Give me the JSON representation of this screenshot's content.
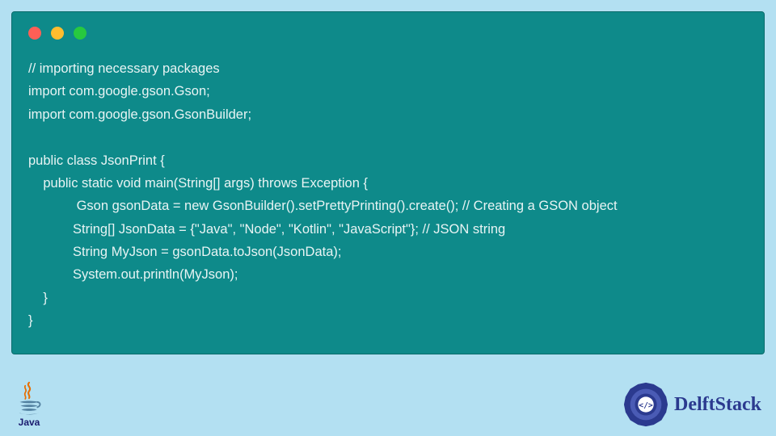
{
  "code": {
    "lines": [
      "// importing necessary packages",
      "import com.google.gson.Gson;",
      "import com.google.gson.GsonBuilder;",
      "",
      "public class JsonPrint {",
      "    public static void main(String[] args) throws Exception {",
      "             Gson gsonData = new GsonBuilder().setPrettyPrinting().create(); // Creating a GSON object",
      "            String[] JsonData = {\"Java\", \"Node\", \"Kotlin\", \"JavaScript\"}; // JSON string",
      "            String MyJson = gsonData.toJson(JsonData);",
      "            System.out.println(MyJson);",
      "    }",
      "}"
    ]
  },
  "footer": {
    "java_label": "Java",
    "brand_label": "DelftStack"
  }
}
